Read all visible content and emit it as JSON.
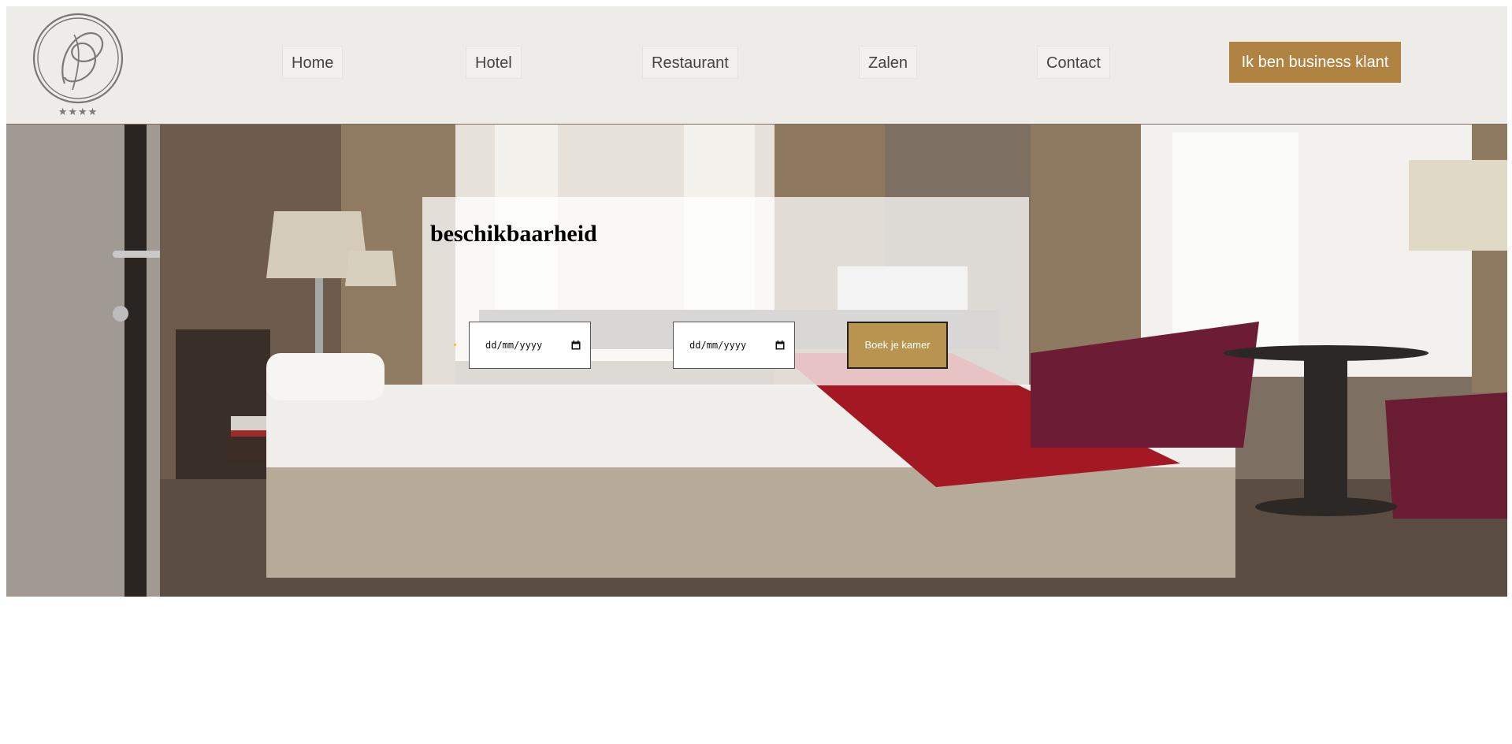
{
  "header": {
    "logo_stars": "★★★★",
    "nav": [
      {
        "label": "Home"
      },
      {
        "label": "Hotel"
      },
      {
        "label": "Restaurant"
      },
      {
        "label": "Zalen"
      },
      {
        "label": "Contact"
      }
    ],
    "business_button": "Ik ben business klant"
  },
  "availability": {
    "title": "beschikbaarheid",
    "checkin_placeholder": "dd/mm/yyyy",
    "checkout_placeholder": "dd/mm/yyyy",
    "book_button": "Boek je kamer"
  },
  "colors": {
    "accent": "#b08342",
    "book_button": "#b8944e",
    "header_bg": "#f5f5f3"
  }
}
